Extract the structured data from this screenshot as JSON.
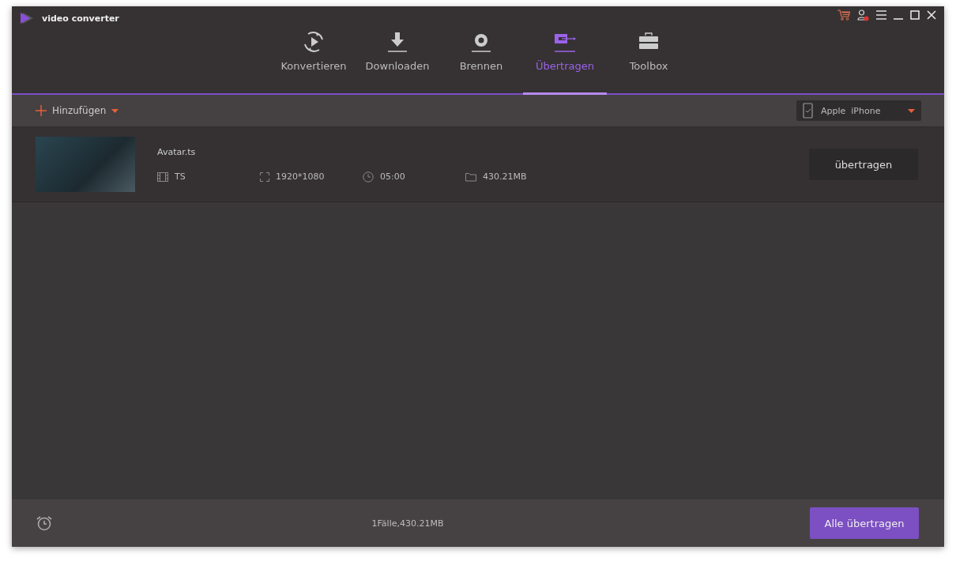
{
  "app": {
    "title": "video converter"
  },
  "tabs": [
    {
      "label": "Konvertieren",
      "kind": "convert",
      "selected": false
    },
    {
      "label": "Downloaden",
      "kind": "download",
      "selected": false
    },
    {
      "label": "Brennen",
      "kind": "burn",
      "selected": false
    },
    {
      "label": "Übertragen",
      "kind": "transfer",
      "selected": true
    },
    {
      "label": "Toolbox",
      "kind": "toolbox",
      "selected": false
    }
  ],
  "toolbar": {
    "add_label": "Hinzufügen",
    "device": "Apple  iPhone"
  },
  "files": [
    {
      "name": "Avatar.ts",
      "format": "TS",
      "resolution": "1920*1080",
      "duration": "05:00",
      "size": "430.21MB",
      "action": "übertragen"
    }
  ],
  "footer": {
    "summary": "1Fälle,430.21MB",
    "button": "Alle übertragen"
  }
}
